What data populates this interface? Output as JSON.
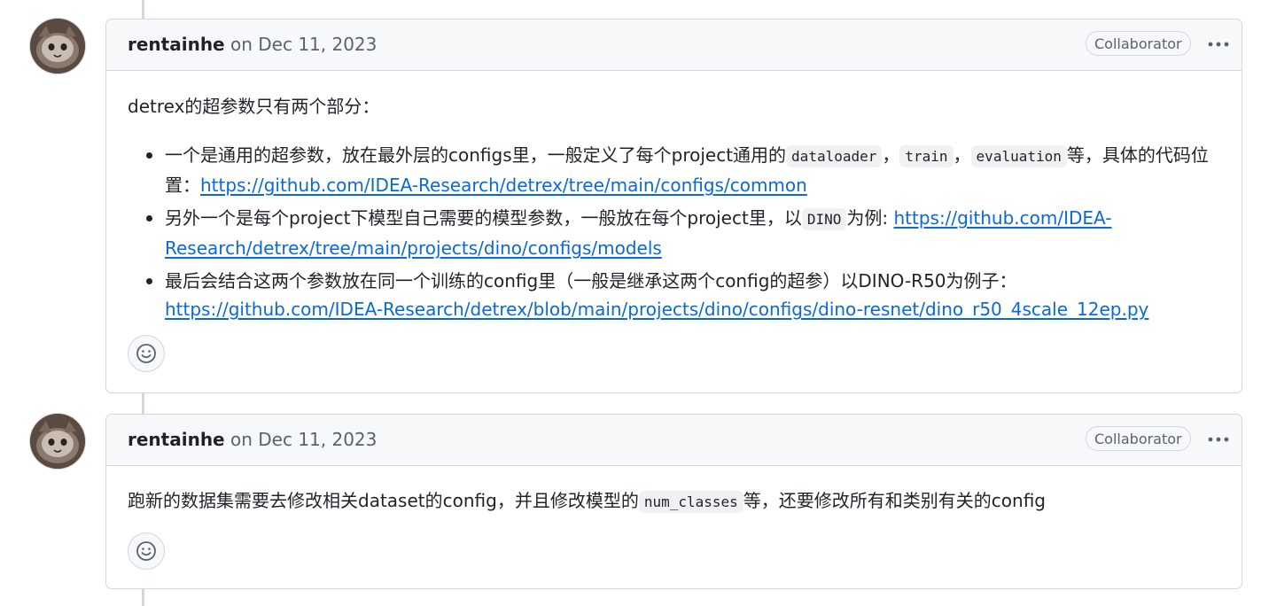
{
  "comments": [
    {
      "author": "rentainhe",
      "timestamp": "on Dec 11, 2023",
      "badge": "Collaborator",
      "intro": "detrex的超参数只有两个部分：",
      "items": [
        {
          "t1": "一个是通用的超参数，放在最外层的configs里，一般定义了每个project通用的",
          "code1": "dataloader",
          "sep1": "，",
          "code2": "train",
          "sep2": "，",
          "code3": "evaluation",
          "t2": "等，具体的代码位置：",
          "link": "https://github.com/IDEA-Research/detrex/tree/main/configs/common"
        },
        {
          "t1": "另外一个是每个project下模型自己需要的模型参数，一般放在每个project里，以",
          "code1": "DINO",
          "t2": "为例: ",
          "link": "https://github.com/IDEA-Research/detrex/tree/main/projects/dino/configs/models"
        },
        {
          "t1": "最后会结合这两个参数放在同一个训练的config里（一般是继承这两个config的超参）以DINO-R50为例子：",
          "link": "https://github.com/IDEA-Research/detrex/blob/main/projects/dino/configs/dino-resnet/dino_r50_4scale_12ep.py"
        }
      ]
    },
    {
      "author": "rentainhe",
      "timestamp": "on Dec 11, 2023",
      "badge": "Collaborator",
      "text1": "跑新的数据集需要去修改相关dataset的config，并且修改模型的",
      "code": "num_classes",
      "text2": "等，还要修改所有和类别有关的config"
    }
  ],
  "icons": {
    "avatar": "cat-avatar",
    "more": "kebab-horizontal-icon",
    "reaction": "smiley-icon"
  },
  "colors": {
    "link": "#0969da",
    "header_bg": "#f6f8fa",
    "border": "#d0d7de",
    "muted": "#59636e"
  }
}
